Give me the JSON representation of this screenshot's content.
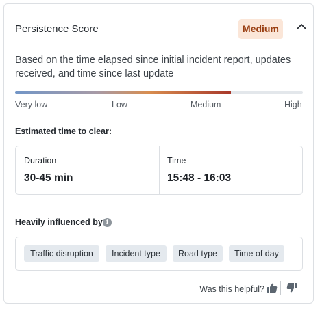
{
  "card": {
    "title": "Persistence Score",
    "badge": "Medium",
    "collapse_icon": "chevron-up-icon",
    "description": "Based on the time elapsed since initial incident report, updates received, and time since last update",
    "score_level": 0.75,
    "scale_labels": [
      "Very low",
      "Low",
      "Medium",
      "High"
    ],
    "colors": {
      "badge_bg": "#fbe6d8",
      "badge_text": "#9a3f12",
      "gradient": [
        "#7296c7",
        "#a79aa6",
        "#d88d4f",
        "#a8382a"
      ]
    }
  },
  "estimate": {
    "heading": "Estimated time to clear:",
    "duration_label": "Duration",
    "duration_value": "30-45 min",
    "time_label": "Time",
    "time_value": "15:48 - 16:03"
  },
  "influence": {
    "heading": "Heavily influenced by",
    "info_icon": "info-icon",
    "tags": [
      "Traffic disruption",
      "Incident type",
      "Road type",
      "Time of day"
    ]
  },
  "feedback": {
    "question": "Was this helpful?",
    "up_icon": "thumbs-up-icon",
    "down_icon": "thumbs-down-icon"
  }
}
